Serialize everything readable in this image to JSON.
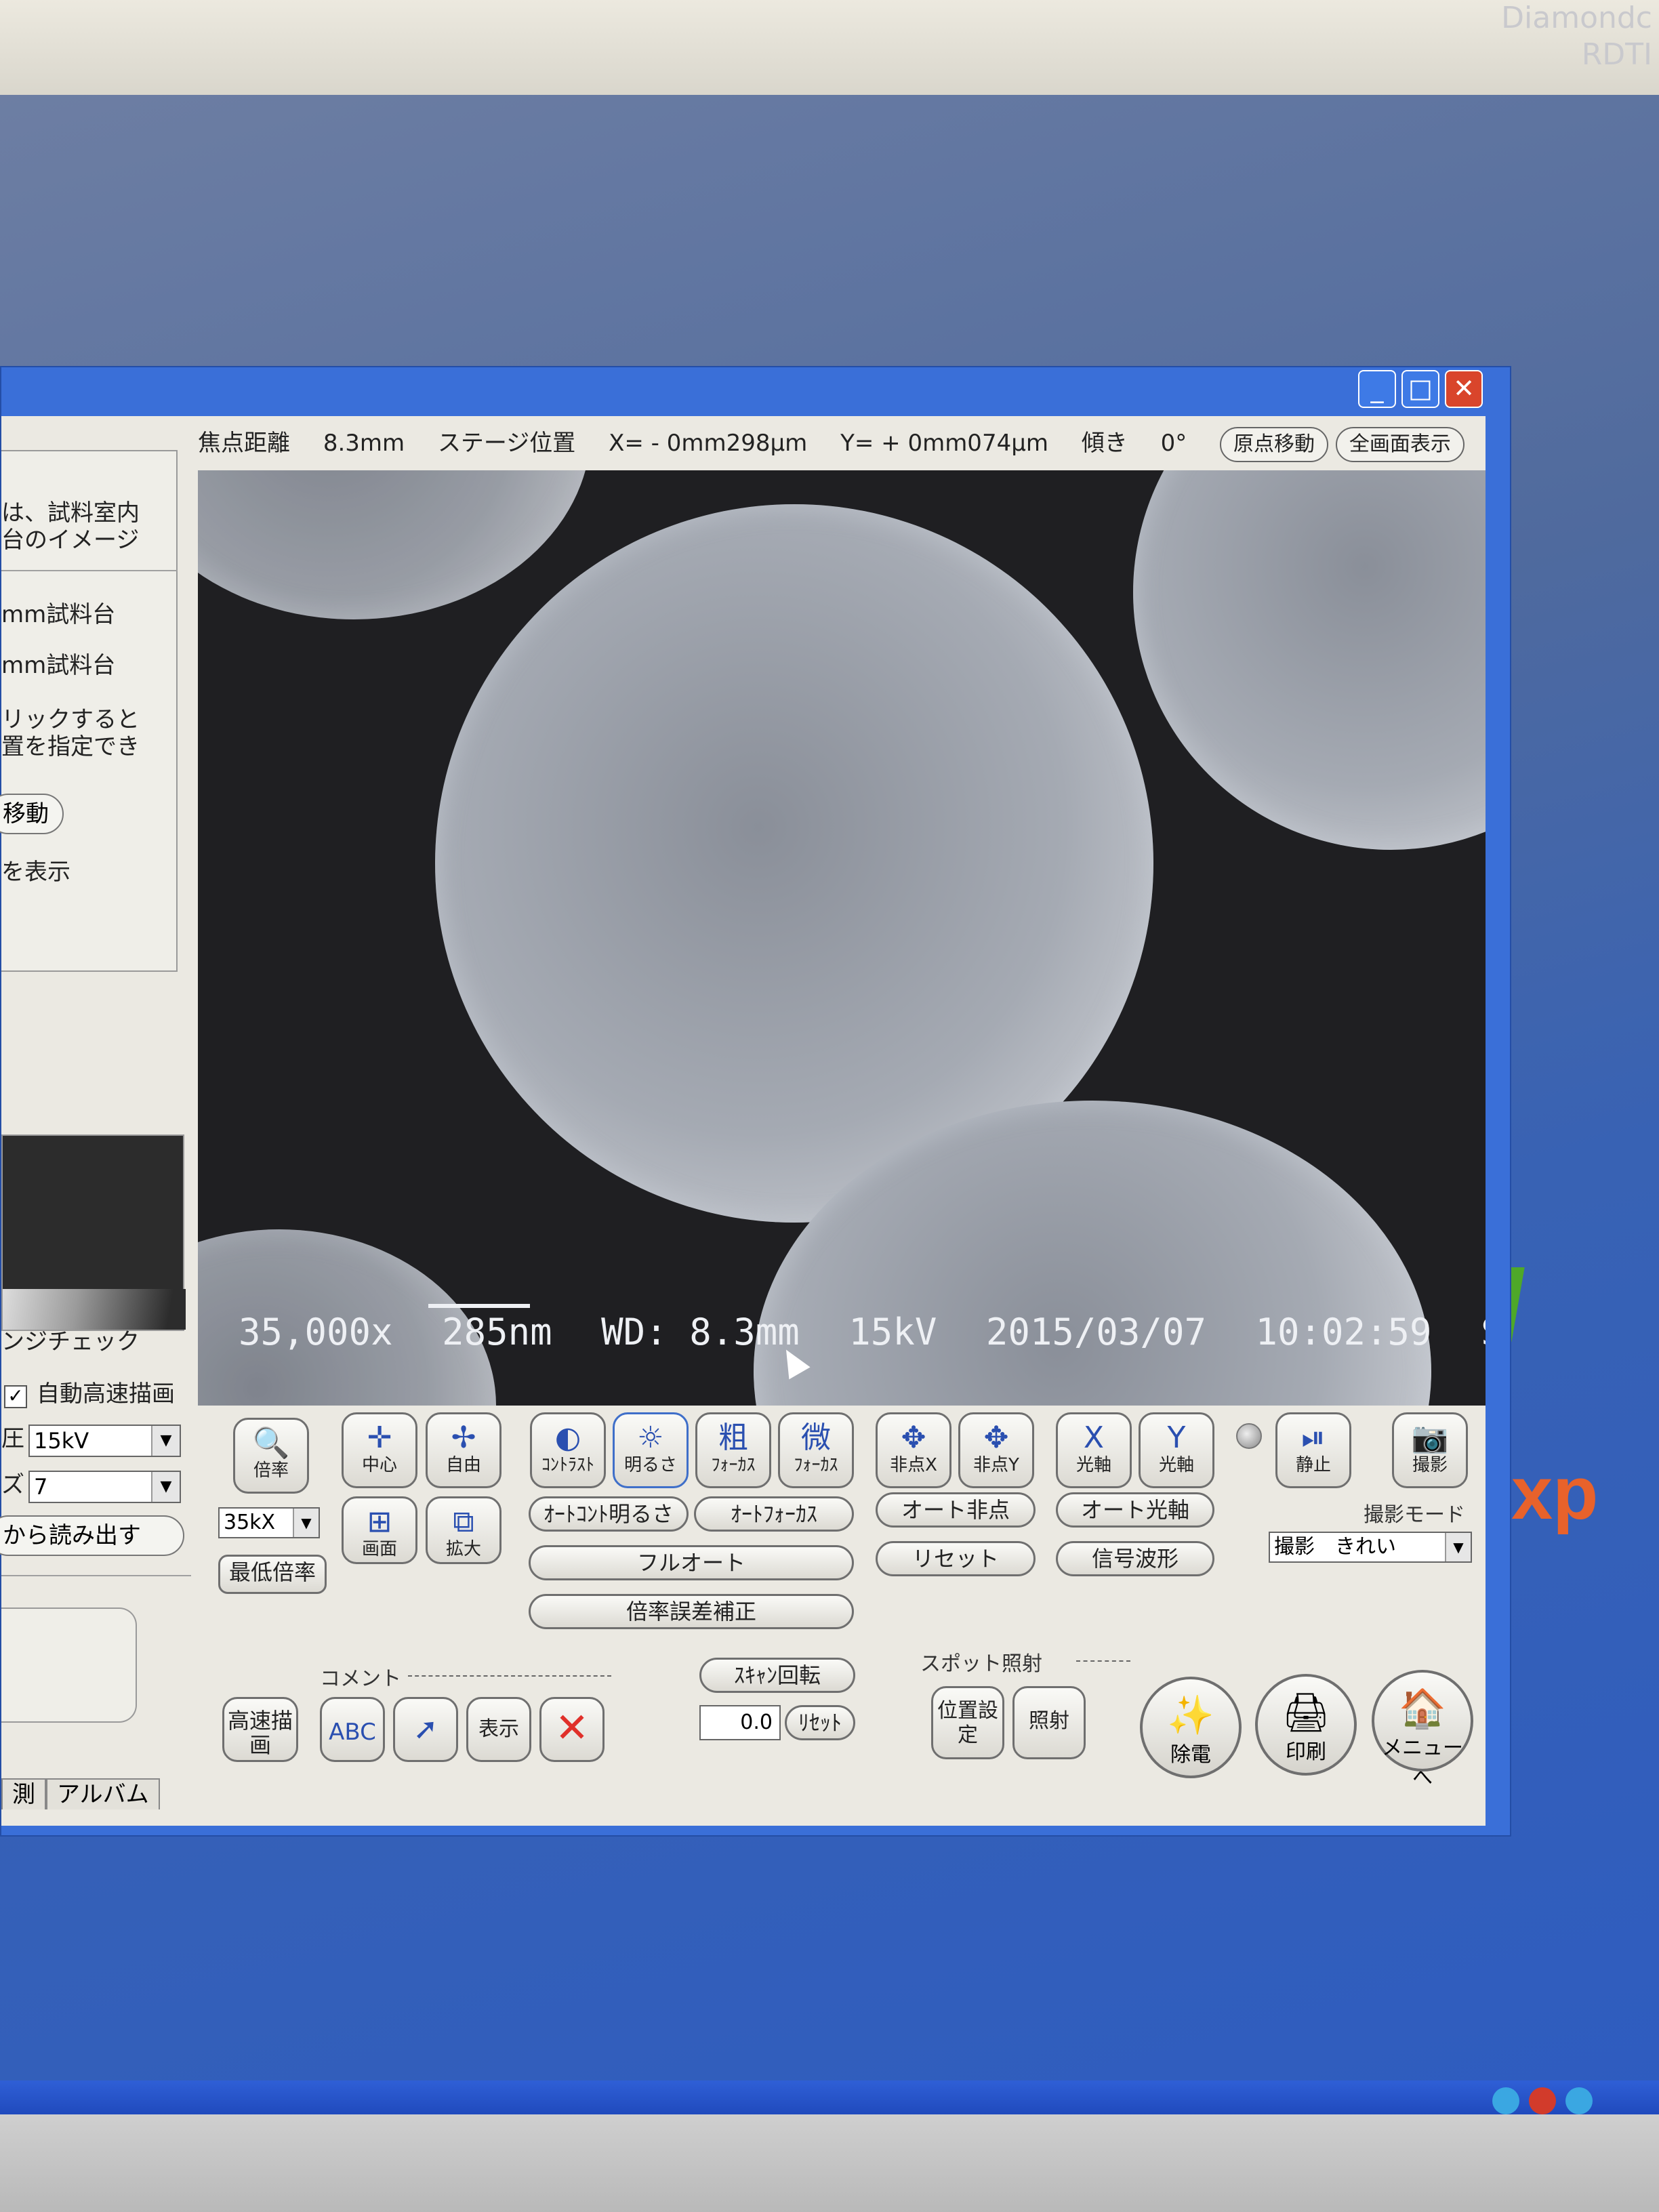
{
  "corner_text": [
    "Diamondc",
    "RDTI"
  ],
  "infobar": {
    "focus_label": "焦点距離",
    "focus_value": "8.3mm",
    "stage_label": "ステージ位置",
    "x_value": "X= -  0mm298μm",
    "y_value": "Y= +  0mm074μm",
    "tilt_label": "傾き",
    "tilt_value": "0°",
    "origin_button": "原点移動",
    "full_display_button": "全画面表示"
  },
  "left_panel": {
    "lines": [
      "は、試料室内",
      "台のイメージ",
      "mm試料台",
      "mm試料台",
      "リックすると",
      "置を指定でき",
      "移動",
      "を表示"
    ],
    "range_check": "ンジチェック",
    "auto_fast_draw": "自動高速描画",
    "voltage_label": "圧",
    "voltage_value": "15kV",
    "size_label": "ズ",
    "size_value": "7",
    "load_button": "から読み出す"
  },
  "status_tabs": [
    "測",
    "アルバム"
  ],
  "sem_label": {
    "magnification": "35,000x",
    "scale": "285nm",
    "wd": "WD: 8.3mm",
    "kv": "15kV",
    "date": "2015/03/07",
    "time": "10:02:59",
    "suffix": "S"
  },
  "controls": {
    "magnify": "倍率",
    "center": "中心",
    "free": "自由",
    "contrast": "ｺﾝﾄﾗｽﾄ",
    "brightness": "明るさ",
    "coarse_focus": "ﾌｫｰｶｽ",
    "coarse_mark": "粗",
    "fine_focus": "ﾌｫｰｶｽ",
    "fine_mark": "微",
    "astig_x": "非点X",
    "astig_y": "非点Y",
    "axis_x": "光軸",
    "axis_y": "光軸",
    "pause": "静止",
    "capture": "撮影",
    "screen": "画面",
    "enlarge": "拡大",
    "mag_select": "35kX",
    "min_mag": "最低倍率",
    "auto_contrast_brightness": "ｵｰﾄｺﾝﾄ明るさ",
    "auto_focus": "ｵｰﾄﾌｫｰｶｽ",
    "full_auto": "フルオート",
    "mag_error_correct": "倍率誤差補正",
    "auto_astig": "オート非点",
    "reset": "リセット",
    "auto_axis": "オート光軸",
    "signal_waveform": "信号波形",
    "capture_mode_label": "撮影モード",
    "capture_mode_value": "撮影　きれい",
    "comment_label": "コメント",
    "fast_draw": "高速描画",
    "text_abc": "ABC",
    "display": "表示",
    "scan_rotate": "ｽｷｬﾝ回転",
    "scan_value": "0.0",
    "scan_reset": "ﾘｾｯﾄ",
    "spot_label": "スポット照射",
    "position_set": "位置設定",
    "irradiate": "照射",
    "discharge": "除電",
    "print": "印刷",
    "menu": "メニューへ"
  },
  "desktop": {
    "xp_logo": "xp"
  },
  "icons": {
    "magnify": "magnifier-icon",
    "center": "crosshair-icon",
    "free": "crosshair-free-icon",
    "contrast": "contrast-icon",
    "brightness": "sun-icon",
    "pause": "play-pause-icon",
    "capture": "camera-icon"
  },
  "colors": {
    "window_blue": "#3a6fd8",
    "close_red": "#d9452b",
    "client_bg": "#ebe9e2"
  }
}
